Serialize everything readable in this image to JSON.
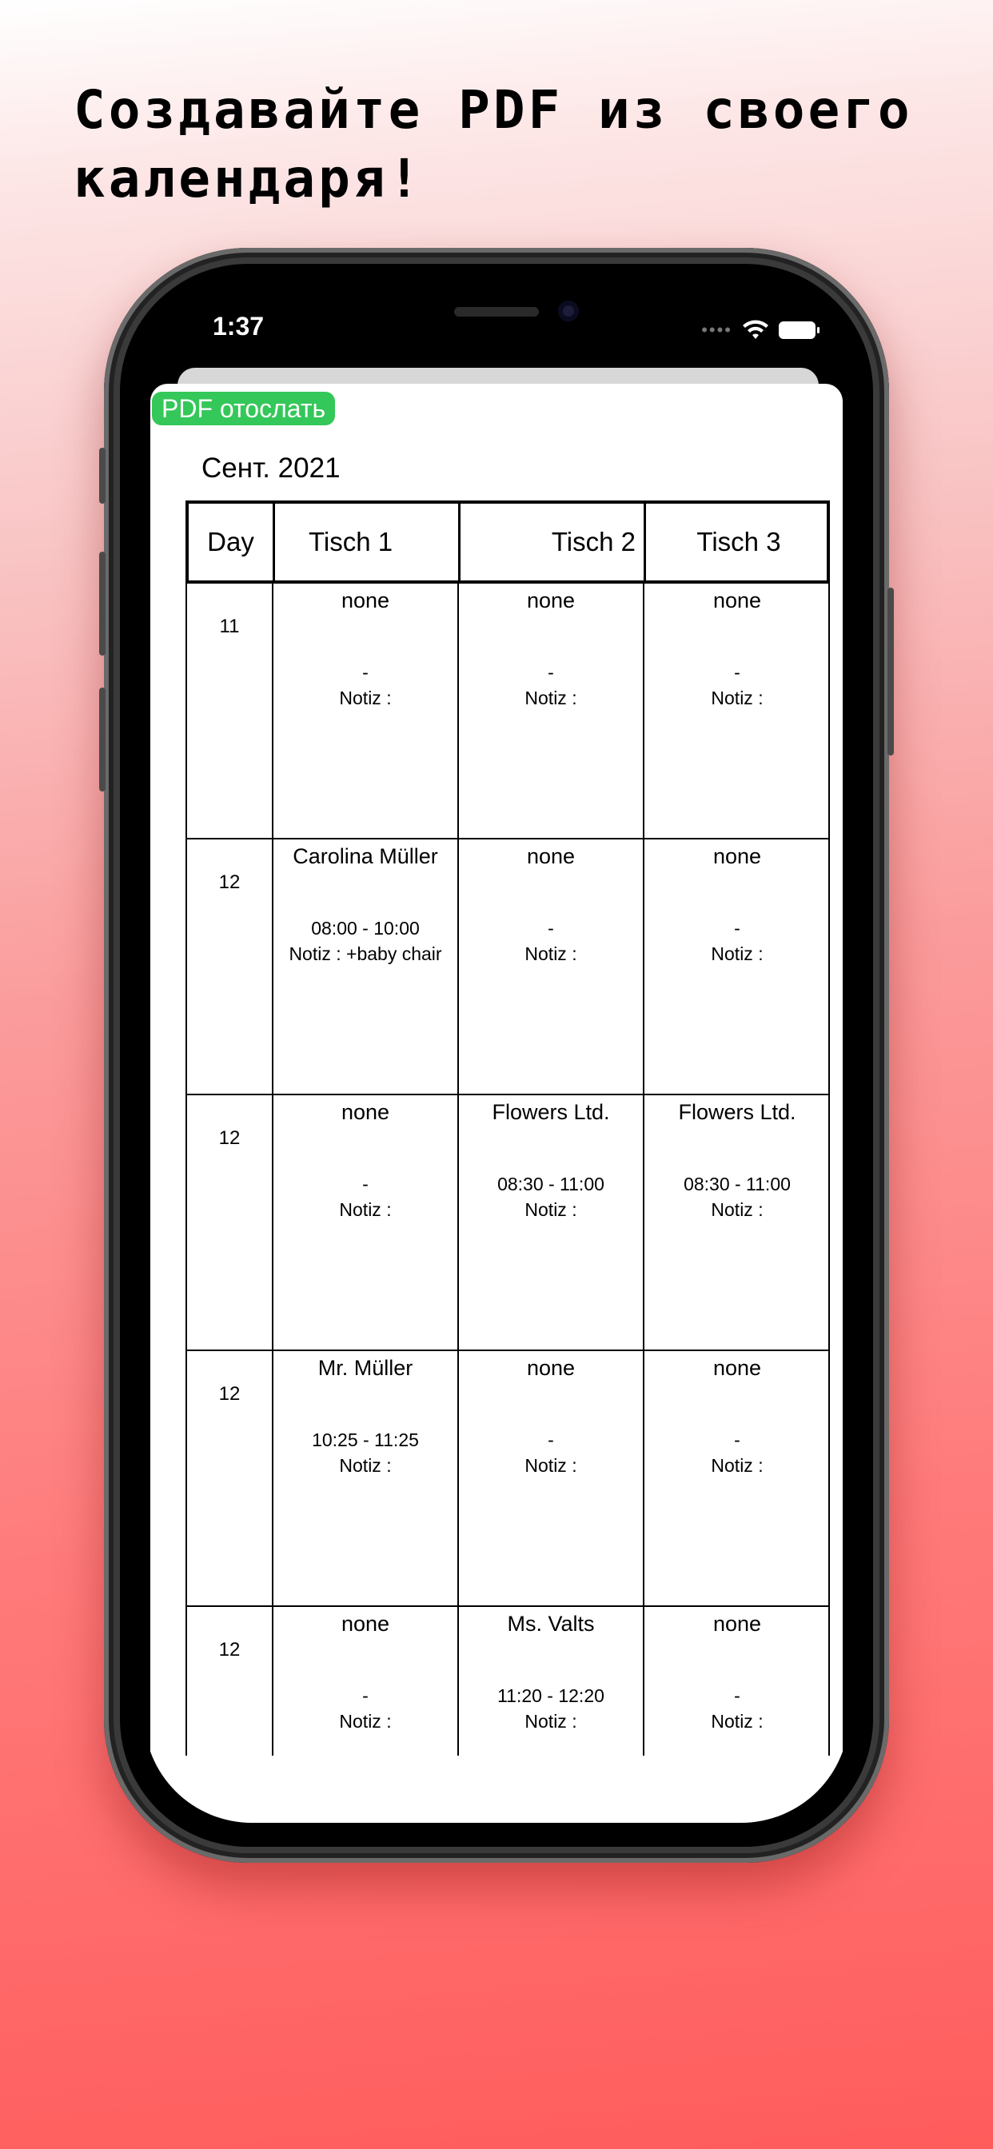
{
  "headline": "Создавайте PDF из своего\nкалендаря!",
  "status_bar": {
    "time": "1:37",
    "dots": "••••"
  },
  "pdf_button_label": "PDF отослать",
  "month_label": "Сент. 2021",
  "table": {
    "headers": [
      "Day",
      "Tisch 1",
      "Tisch 2",
      "Tisch 3"
    ],
    "rows": [
      {
        "day": "11",
        "cells": [
          {
            "name": "none",
            "time": "-",
            "note": "Notiz :"
          },
          {
            "name": "none",
            "time": "-",
            "note": "Notiz :"
          },
          {
            "name": "none",
            "time": "-",
            "note": "Notiz :"
          }
        ]
      },
      {
        "day": "12",
        "cells": [
          {
            "name": "Carolina Müller",
            "time": "08:00  - 10:00",
            "note": "Notiz : +baby chair"
          },
          {
            "name": "none",
            "time": "-",
            "note": "Notiz :"
          },
          {
            "name": "none",
            "time": "-",
            "note": "Notiz :"
          }
        ]
      },
      {
        "day": "12",
        "cells": [
          {
            "name": "none",
            "time": "-",
            "note": "Notiz :"
          },
          {
            "name": "Flowers Ltd.",
            "time": "08:30  - 11:00",
            "note": "Notiz :"
          },
          {
            "name": "Flowers Ltd.",
            "time": "08:30  - 11:00",
            "note": "Notiz :"
          }
        ]
      },
      {
        "day": "12",
        "cells": [
          {
            "name": "Mr. Müller",
            "time": "10:25  - 11:25",
            "note": "Notiz :"
          },
          {
            "name": "none",
            "time": "-",
            "note": "Notiz :"
          },
          {
            "name": "none",
            "time": "-",
            "note": "Notiz :"
          }
        ]
      },
      {
        "day": "12",
        "cells": [
          {
            "name": "none",
            "time": "-",
            "note": "Notiz :"
          },
          {
            "name": "Ms. Valts",
            "time": "11:20  - 12:20",
            "note": "Notiz :"
          },
          {
            "name": "none",
            "time": "-",
            "note": "Notiz :"
          }
        ]
      }
    ]
  },
  "colors": {
    "pdf_button": "#34c759",
    "background_top": "#ffffff",
    "background_bottom": "#ff5c5c"
  },
  "icons": [
    "wifi-icon",
    "battery-icon"
  ]
}
